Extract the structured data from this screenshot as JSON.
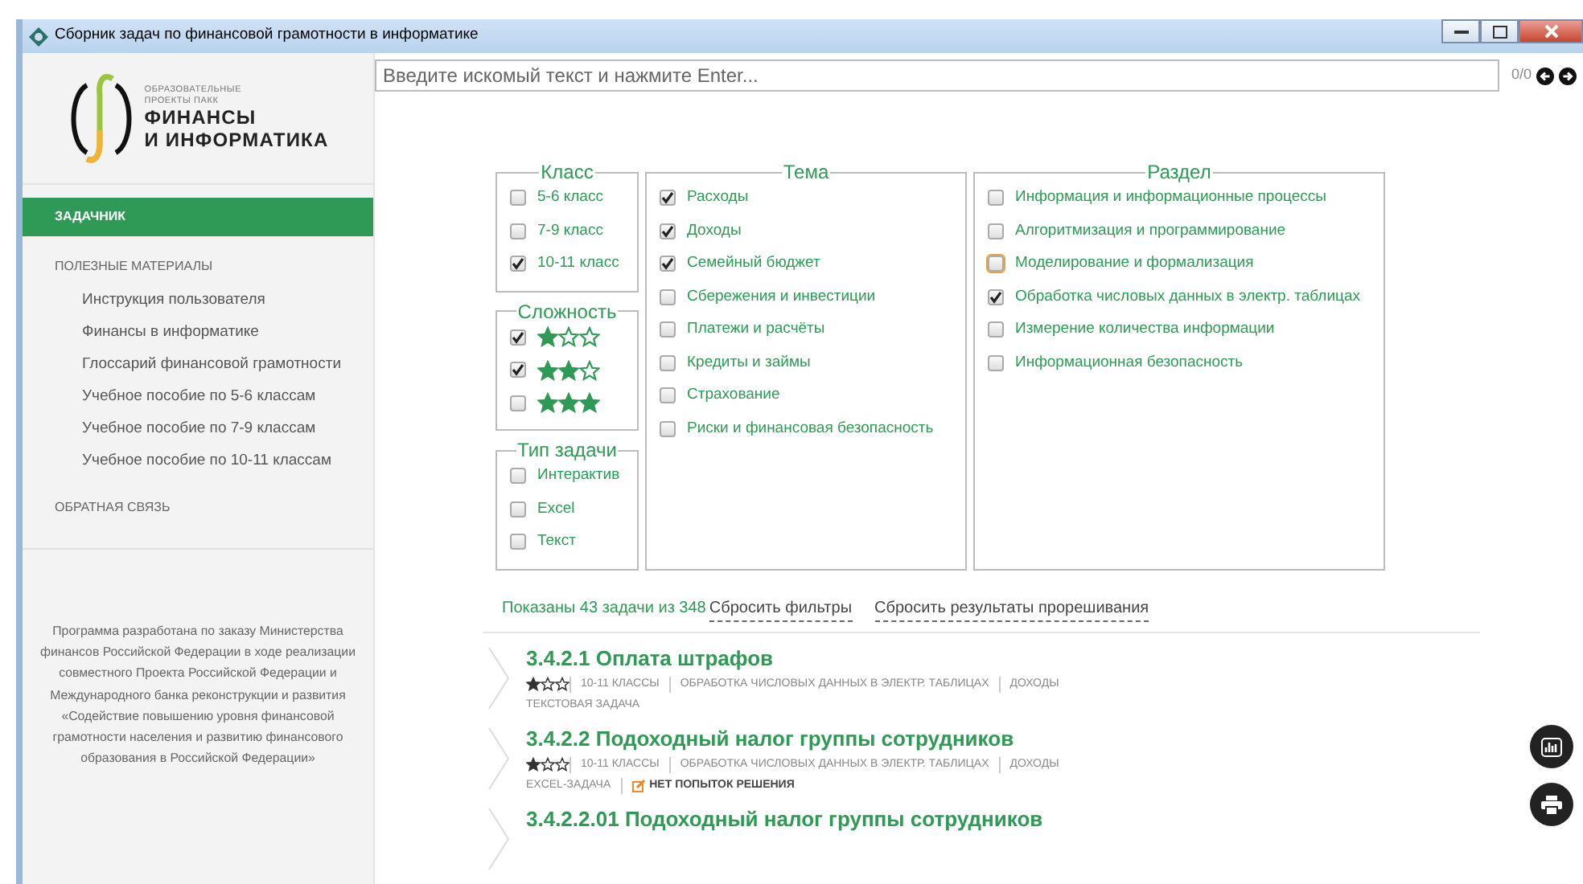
{
  "window": {
    "title": "Сборник задач по финансовой грамотности в информатике"
  },
  "search": {
    "placeholder": "Введите искомый текст и нажмите Enter...",
    "counter": "0/0"
  },
  "logo": {
    "subtitle": [
      "ОБРАЗОВАТЕЛЬНЫЕ",
      "ПРОЕКТЫ ПАКК"
    ],
    "title": [
      "ФИНАНСЫ",
      "И ИНФОРМАТИКА"
    ]
  },
  "sidebar": {
    "sections": [
      {
        "label": "ЗАДАЧНИК",
        "selected": true
      },
      {
        "label": "ПОЛЕЗНЫЕ МАТЕРИАЛЫ",
        "selected": false,
        "children": [
          {
            "label": "Инструкция пользователя"
          },
          {
            "label": "Финансы в информатике"
          },
          {
            "label": "Глоссарий финансовой грамотности"
          },
          {
            "label": "Учебное пособие по 5-6 классам"
          },
          {
            "label": "Учебное пособие по 7-9 классам"
          },
          {
            "label": "Учебное пособие по 10-11 классам"
          }
        ]
      },
      {
        "label": "ОБРАТНАЯ СВЯЗЬ",
        "selected": false
      }
    ],
    "note": "Программа разработана по заказу Министерства финансов Российской Федерации в ходе реализации совместного Проекта Российской Федерации и Международного банка реконструкции и развития «Содействие повышению уровня финансовой грамотности населения и развитию финансового образования в Российской Федерации»"
  },
  "filters": [
    {
      "title": "Класс",
      "options": [
        {
          "kind": "text",
          "label": "5-6 класс",
          "checked": false,
          "focused": false
        },
        {
          "kind": "text",
          "label": "7-9 класс",
          "checked": false,
          "focused": false
        },
        {
          "kind": "text",
          "label": "10-11 класс",
          "checked": true,
          "focused": false
        }
      ]
    },
    {
      "title": "Сложность",
      "options": [
        {
          "kind": "stars",
          "stars": 1,
          "checked": true,
          "focused": false
        },
        {
          "kind": "stars",
          "stars": 2,
          "checked": true,
          "focused": false
        },
        {
          "kind": "stars",
          "stars": 3,
          "checked": false,
          "focused": false
        }
      ]
    },
    {
      "title": "Тип задачи",
      "options": [
        {
          "kind": "text",
          "label": "Интерактив",
          "checked": false,
          "focused": false
        },
        {
          "kind": "text",
          "label": "Excel",
          "checked": false,
          "focused": false
        },
        {
          "kind": "text",
          "label": "Текст",
          "checked": false,
          "focused": false
        }
      ]
    },
    {
      "title": "Тема",
      "options": [
        {
          "kind": "text",
          "label": "Расходы",
          "checked": true,
          "focused": false
        },
        {
          "kind": "text",
          "label": "Доходы",
          "checked": true,
          "focused": false
        },
        {
          "kind": "text",
          "label": "Семейный бюджет",
          "checked": true,
          "focused": false
        },
        {
          "kind": "text",
          "label": "Сбережения и инвестиции",
          "checked": false,
          "focused": false
        },
        {
          "kind": "text",
          "label": "Платежи и расчёты",
          "checked": false,
          "focused": false
        },
        {
          "kind": "text",
          "label": "Кредиты и займы",
          "checked": false,
          "focused": false
        },
        {
          "kind": "text",
          "label": "Страхование",
          "checked": false,
          "focused": false
        },
        {
          "kind": "text",
          "label": "Риски и финансовая безопасность",
          "checked": false,
          "focused": false
        }
      ]
    },
    {
      "title": "Раздел",
      "options": [
        {
          "kind": "text",
          "label": "Информация и информационные процессы",
          "checked": false,
          "focused": false
        },
        {
          "kind": "text",
          "label": "Алгоритмизация и программирование",
          "checked": false,
          "focused": false
        },
        {
          "kind": "text",
          "label": "Моделирование и формализация",
          "checked": false,
          "focused": true
        },
        {
          "kind": "text",
          "label": "Обработка числовых данных в электр. таблицах",
          "checked": true,
          "focused": false
        },
        {
          "kind": "text",
          "label": "Измерение количества информации",
          "checked": false,
          "focused": false
        },
        {
          "kind": "text",
          "label": "Информационная безопасность",
          "checked": false,
          "focused": false
        }
      ]
    }
  ],
  "summary": {
    "text": "Показаны 43 задачи из 348",
    "links": [
      "Сбросить фильтры",
      "Сбросить результаты прорешивания"
    ]
  },
  "tasks": [
    {
      "title": "3.4.2.1 Оплата штрафов",
      "stars": 1,
      "meta": [
        "10-11 КЛАССЫ",
        "ОБРАБОТКА ЧИСЛОВЫХ ДАННЫХ В ЭЛЕКТР. ТАБЛИЦАХ",
        "ДОХОДЫ"
      ],
      "type": "ТЕКСТОВАЯ ЗАДАЧА"
    },
    {
      "title": "3.4.2.2 Подоходный налог группы сотрудников",
      "stars": 1,
      "meta": [
        "10-11 КЛАССЫ",
        "ОБРАБОТКА ЧИСЛОВЫХ ДАННЫХ В ЭЛЕКТР. ТАБЛИЦАХ",
        "ДОХОДЫ"
      ],
      "type": "EXCEL-ЗАДАЧА",
      "status": "НЕТ ПОПЫТОК РЕШЕНИЯ"
    },
    {
      "title": "3.4.2.2.01 Подоходный налог группы сотрудников"
    }
  ]
}
